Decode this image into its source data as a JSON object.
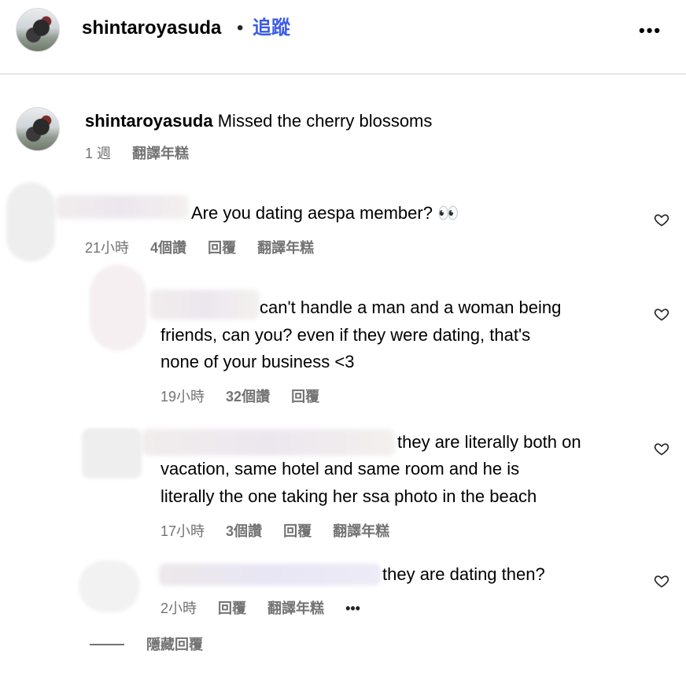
{
  "header": {
    "username": "shintaroyasuda",
    "separator": "•",
    "follow_label": "追蹤",
    "more_label": "•••"
  },
  "caption": {
    "username": "shintaroyasuda",
    "text": "Missed the cherry blossoms",
    "time": "1 週",
    "translate": "翻譯年糕"
  },
  "comments": [
    {
      "text": "Are you dating aespa member? 👀",
      "time": "21小時",
      "likes": "4個讚",
      "reply": "回覆",
      "translate": "翻譯年糕"
    },
    {
      "line1": "can't handle a man and a woman being",
      "line2": "friends, can you? even if they were dating, that's",
      "line3": "none of your business <3",
      "time": "19小時",
      "likes": "32個讚",
      "reply": "回覆"
    },
    {
      "line1": "they are literally both on",
      "line2": "vacation, same hotel and same room and he is",
      "line3": "literally the one taking her ssa photo in the beach",
      "time": "17小時",
      "likes": "3個讚",
      "reply": "回覆",
      "translate": "翻譯年糕"
    },
    {
      "text": "they are dating then?",
      "time": "2小時",
      "reply": "回覆",
      "translate": "翻譯年糕",
      "more": "•••"
    }
  ],
  "hide_replies": "隱藏回覆"
}
